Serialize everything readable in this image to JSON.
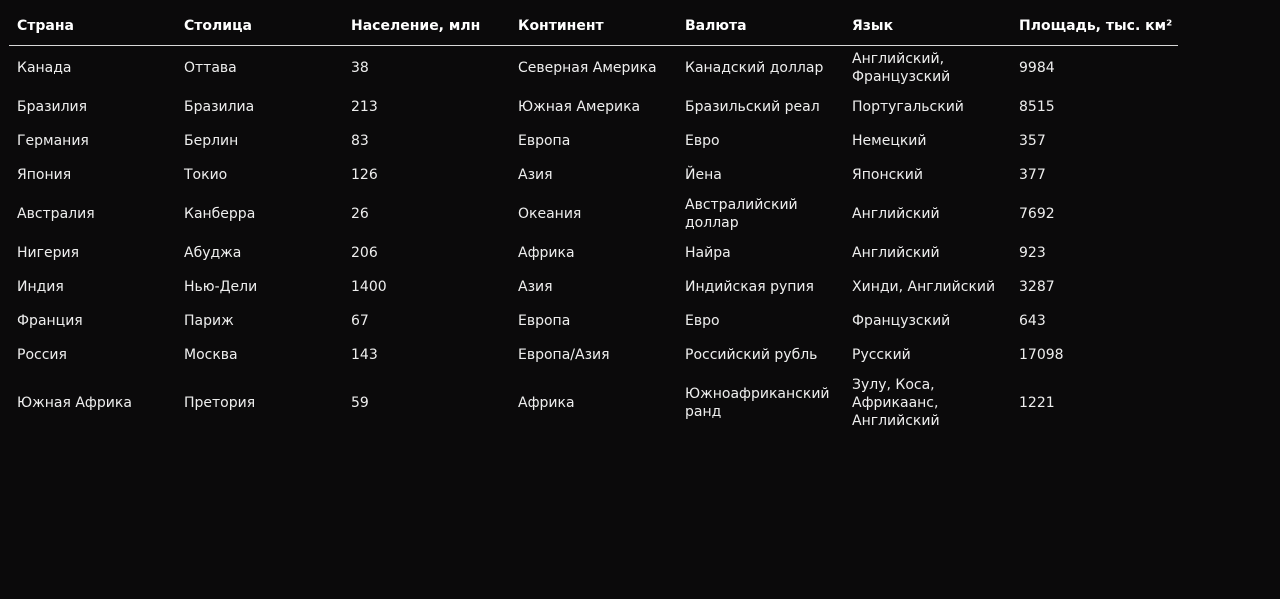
{
  "table": {
    "columns": [
      "Страна",
      "Столица",
      "Население, млн",
      "Континент",
      "Валюта",
      "Язык",
      "Площадь, тыс. км²"
    ],
    "rows": [
      [
        "Канада",
        "Оттава",
        "38",
        "Северная Америка",
        "Канадский доллар",
        "Английский, Французский",
        "9984"
      ],
      [
        "Бразилия",
        "Бразилиа",
        "213",
        "Южная Америка",
        "Бразильский реал",
        "Португальский",
        "8515"
      ],
      [
        "Германия",
        "Берлин",
        "83",
        "Европа",
        "Евро",
        "Немецкий",
        "357"
      ],
      [
        "Япония",
        "Токио",
        "126",
        "Азия",
        "Йена",
        "Японский",
        "377"
      ],
      [
        "Австралия",
        "Канберра",
        "26",
        "Океания",
        "Австралийский доллар",
        "Английский",
        "7692"
      ],
      [
        "Нигерия",
        "Абуджа",
        "206",
        "Африка",
        "Найра",
        "Английский",
        "923"
      ],
      [
        "Индия",
        "Нью-Дели",
        "1400",
        "Азия",
        "Индийская рупия",
        "Хинди, Английский",
        "3287"
      ],
      [
        "Франция",
        "Париж",
        "67",
        "Европа",
        "Евро",
        "Французский",
        "643"
      ],
      [
        "Россия",
        "Москва",
        "143",
        "Европа/Азия",
        "Российский рубль",
        "Русский",
        "17098"
      ],
      [
        "Южная Африка",
        "Претория",
        "59",
        "Африка",
        "Южноафриканский ранд",
        "Зулу, Коса, Африкаанс, Английский",
        "1221"
      ]
    ]
  }
}
